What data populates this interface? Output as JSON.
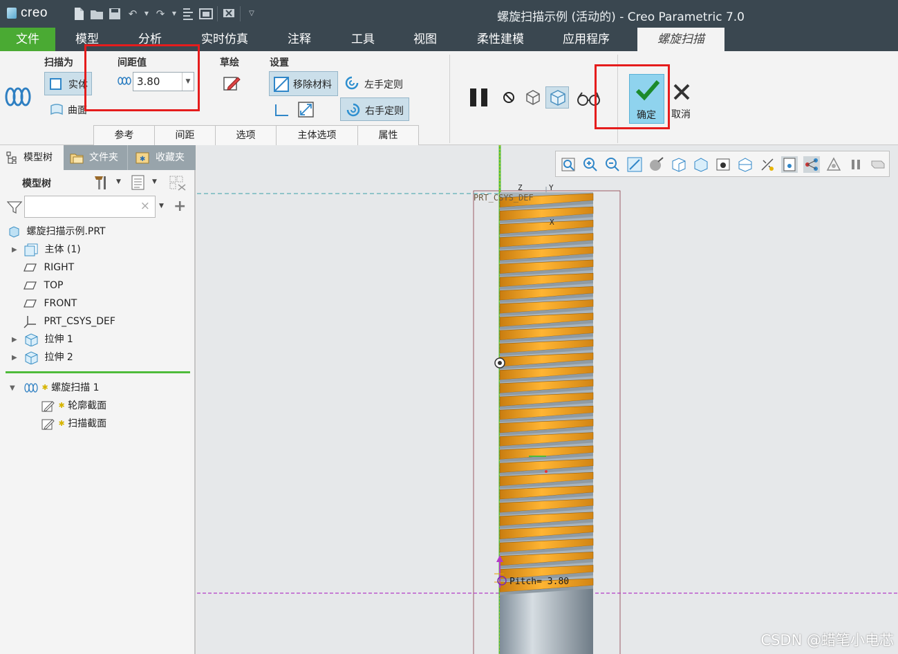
{
  "app": {
    "logo_text": "creo",
    "window_title": "螺旋扫描示例 (活动的) - Creo Parametric 7.0"
  },
  "tabs": [
    "文件",
    "模型",
    "分析",
    "实时仿真",
    "注释",
    "工具",
    "视图",
    "柔性建模",
    "应用程序",
    "螺旋扫描"
  ],
  "ribbon": {
    "sweep_as": {
      "title": "扫描为",
      "solid": "实体",
      "surface": "曲面"
    },
    "pitch": {
      "title": "间距值",
      "value": "3.80"
    },
    "sketch": {
      "title": "草绘"
    },
    "settings": {
      "title": "设置",
      "remove_material": "移除材料",
      "left_hand": "左手定则",
      "right_hand": "右手定则"
    },
    "ok": "确定",
    "cancel": "取消",
    "subtabs": [
      "参考",
      "间距",
      "选项",
      "主体选项",
      "属性"
    ]
  },
  "left_panel": {
    "tabs": [
      "模型树",
      "文件夹",
      "收藏夹"
    ],
    "heading": "模型树",
    "filter_placeholder": "",
    "tree": [
      {
        "label": "螺旋扫描示例.PRT"
      },
      {
        "label": "主体 (1)"
      },
      {
        "label": "RIGHT"
      },
      {
        "label": "TOP"
      },
      {
        "label": "FRONT"
      },
      {
        "label": "PRT_CSYS_DEF"
      },
      {
        "label": "拉伸 1"
      },
      {
        "label": "拉伸 2"
      }
    ],
    "insert_tree": [
      {
        "label": "螺旋扫描 1"
      },
      {
        "label": "轮廓截面"
      },
      {
        "label": "扫描截面"
      }
    ]
  },
  "graphics": {
    "csys_label": "PRT_CSYS_DEF",
    "axis_z": "Z",
    "axis_y": "Y",
    "axis_x": "X",
    "pitch_label": "Pitch= 3.80",
    "watermark": "CSDN @蜡笔小电芯"
  },
  "colors": {
    "title_bar": "#3a4750",
    "file_tab": "#4aaa33",
    "thread": "#f5a21c",
    "highlight": "#e51c1c"
  }
}
